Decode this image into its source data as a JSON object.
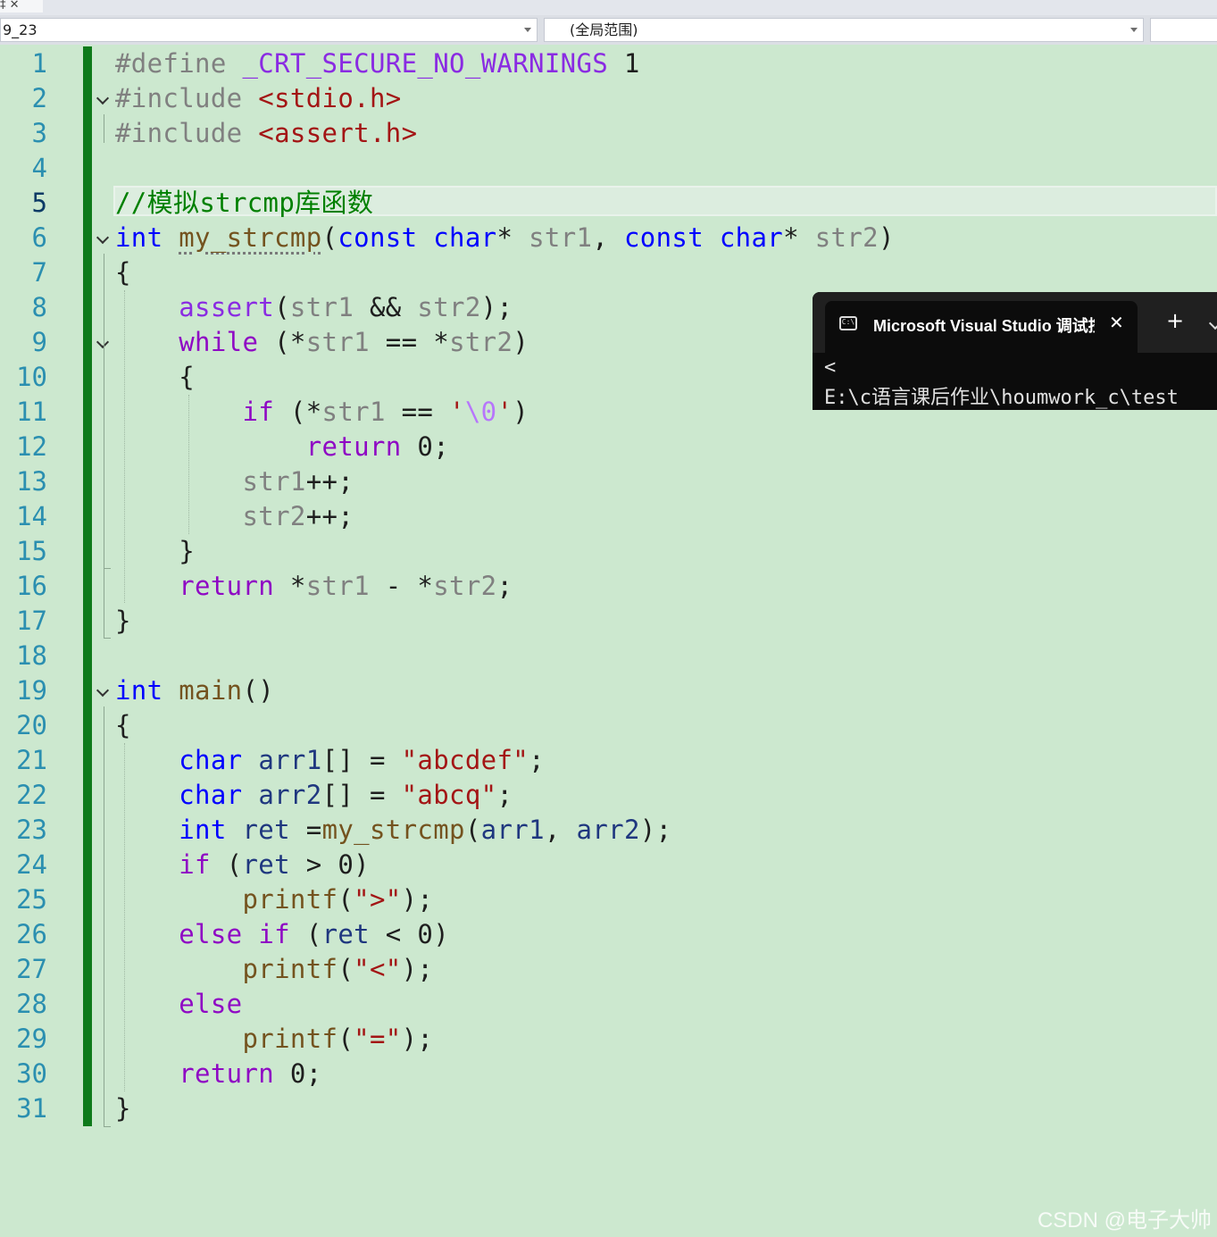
{
  "top_strip": {
    "tab_stub": "‡ ✕"
  },
  "nav": {
    "file_combo": "9_23",
    "scope_combo": "(全局范围)",
    "member_combo": ""
  },
  "editor": {
    "current_line": "5",
    "lines": [
      {
        "n": "1"
      },
      {
        "n": "2"
      },
      {
        "n": "3"
      },
      {
        "n": "4"
      },
      {
        "n": "5"
      },
      {
        "n": "6"
      },
      {
        "n": "7"
      },
      {
        "n": "8"
      },
      {
        "n": "9"
      },
      {
        "n": "10"
      },
      {
        "n": "11"
      },
      {
        "n": "12"
      },
      {
        "n": "13"
      },
      {
        "n": "14"
      },
      {
        "n": "15"
      },
      {
        "n": "16"
      },
      {
        "n": "17"
      },
      {
        "n": "18"
      },
      {
        "n": "19"
      },
      {
        "n": "20"
      },
      {
        "n": "21"
      },
      {
        "n": "22"
      },
      {
        "n": "23"
      },
      {
        "n": "24"
      },
      {
        "n": "25"
      },
      {
        "n": "26"
      },
      {
        "n": "27"
      },
      {
        "n": "28"
      },
      {
        "n": "29"
      },
      {
        "n": "30"
      },
      {
        "n": "31"
      }
    ],
    "code": {
      "l1": [
        "#define ",
        "_CRT_SECURE_NO_WARNINGS",
        " 1"
      ],
      "l2": [
        "#include ",
        "<stdio.h>"
      ],
      "l3": [
        "#include ",
        "<assert.h>"
      ],
      "l5": [
        "//模拟strcmp库函数"
      ],
      "l6": [
        "int",
        " ",
        "my_strcmp",
        "(",
        "const",
        " ",
        "char",
        "* ",
        "str1",
        ", ",
        "const",
        " ",
        "char",
        "* ",
        "str2",
        ")"
      ],
      "l7": [
        "{"
      ],
      "l8": [
        "    ",
        "assert",
        "(",
        "str1",
        " && ",
        "str2",
        ");"
      ],
      "l9": [
        "    ",
        "while",
        " (*",
        "str1",
        " == *",
        "str2",
        ")"
      ],
      "l10": [
        "    {"
      ],
      "l11": [
        "        ",
        "if",
        " (*",
        "str1",
        " == ",
        "'",
        "\\0",
        "'",
        ")"
      ],
      "l12": [
        "            ",
        "return",
        " 0;"
      ],
      "l13": [
        "        ",
        "str1",
        "++;"
      ],
      "l14": [
        "        ",
        "str2",
        "++;"
      ],
      "l15": [
        "    }"
      ],
      "l16": [
        "    ",
        "return",
        " *",
        "str1",
        " - *",
        "str2",
        ";"
      ],
      "l17": [
        "}"
      ],
      "l19": [
        "int",
        " ",
        "main",
        "()"
      ],
      "l20": [
        "{"
      ],
      "l21": [
        "    ",
        "char",
        " ",
        "arr1",
        "[] = ",
        "\"abcdef\"",
        ";"
      ],
      "l22": [
        "    ",
        "char",
        " ",
        "arr2",
        "[] = ",
        "\"abcq\"",
        ";"
      ],
      "l23": [
        "    ",
        "int",
        " ",
        "ret",
        " =",
        "my_strcmp",
        "(",
        "arr1",
        ", ",
        "arr2",
        ");"
      ],
      "l24": [
        "    ",
        "if",
        " (",
        "ret",
        " > 0)"
      ],
      "l25": [
        "        ",
        "printf",
        "(",
        "\">\"",
        ");"
      ],
      "l26": [
        "    ",
        "else",
        " ",
        "if",
        " (",
        "ret",
        " < 0)"
      ],
      "l27": [
        "        ",
        "printf",
        "(",
        "\"<\"",
        ");"
      ],
      "l28": [
        "    ",
        "else"
      ],
      "l29": [
        "        ",
        "printf",
        "(",
        "\"=\"",
        ");"
      ],
      "l30": [
        "    ",
        "return",
        " 0;"
      ],
      "l31": [
        "}"
      ]
    }
  },
  "terminal": {
    "tab_title": "Microsoft Visual Studio 调试控",
    "tab_icon_text": "C:\\",
    "close_glyph": "✕",
    "new_tab_glyph": "+",
    "output": [
      "<",
      "E:\\c语言课后作业\\houmwork_c\\test"
    ]
  },
  "watermark": "CSDN @电子大帅",
  "colors": {
    "editor_bg": "#cce8cf",
    "change_bar": "#0e7a1b",
    "keyword": "#0000ff",
    "control": "#8f08c4",
    "string": "#a31515",
    "comment": "#008000",
    "macro": "#8a2be2",
    "terminal_bg": "#0c0c0c"
  }
}
